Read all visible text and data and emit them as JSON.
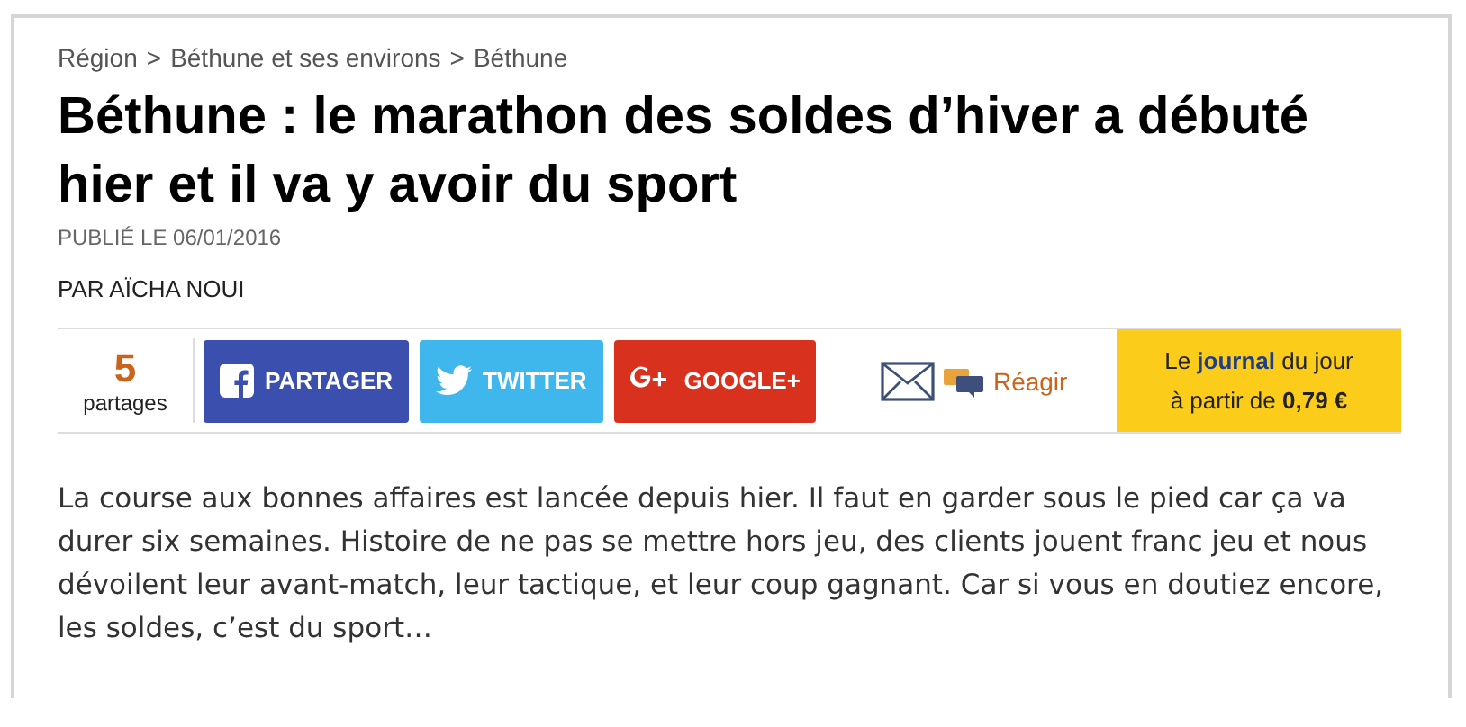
{
  "breadcrumb": {
    "separator": ">",
    "items": [
      "Région",
      "Béthune et ses environs",
      "Béthune"
    ]
  },
  "title": "Béthune : le marathon des soldes d’hiver a débuté hier et il va y avoir du sport",
  "published": "PUBLIÉ LE 06/01/2016",
  "author": "PAR AÏCHA NOUI",
  "share": {
    "count": "5",
    "count_label": "partages",
    "buttons": [
      {
        "kind": "facebook",
        "label": "PARTAGER"
      },
      {
        "kind": "twitter",
        "label": "TWITTER"
      },
      {
        "kind": "google",
        "label": "GOOGLE+"
      }
    ],
    "react": "Réagir"
  },
  "promo": {
    "line_1": "Le **journal** du jour",
    "line_2": "à partir de **0,79 €**"
  },
  "body": "La course aux bonnes affaires est lancée depuis hier. Il faut en garder sous le pied car ça va durer six semaines. Histoire de ne pas se mettre hors jeu, des clients jouent franc jeu et nous dévoilent leur avant-match, leur tactique, et leur coup gagnant. Car si vous en doutiez encore, les soldes, c’est du sport…"
}
